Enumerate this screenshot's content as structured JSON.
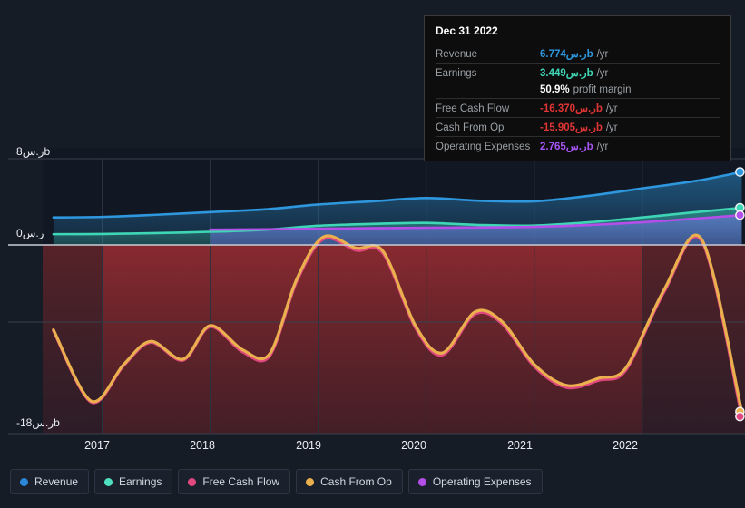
{
  "chart_data": {
    "type": "area",
    "title": "",
    "xlabel": "",
    "ylabel": "",
    "currency_suffix": "ر.سb",
    "xlim": [
      2016.45,
      2022.95
    ],
    "ylim": [
      -18,
      8
    ],
    "grid": true,
    "legend_position": "bottom",
    "x_ticks": [
      "2017",
      "2018",
      "2019",
      "2020",
      "2021",
      "2022"
    ],
    "y_ticks": [
      "8ر.سb",
      "0ر.س",
      "-18ر.سb"
    ],
    "y_tick_values": [
      8,
      0,
      -18
    ],
    "series": [
      {
        "name": "Revenue",
        "color": "#2e97de",
        "fill": "#15496e",
        "x": [
          2016.55,
          2017.0,
          2017.5,
          2018.0,
          2018.5,
          2019.0,
          2019.5,
          2020.0,
          2020.5,
          2021.0,
          2021.5,
          2022.0,
          2022.5,
          2022.92
        ],
        "values": [
          2.55,
          2.6,
          2.8,
          3.05,
          3.3,
          3.75,
          4.05,
          4.35,
          4.1,
          4.05,
          4.55,
          5.25,
          5.95,
          6.774
        ]
      },
      {
        "name": "Earnings",
        "color": "#3fd6b5",
        "fill": "#1c5a5c",
        "x": [
          2016.55,
          2017.0,
          2017.5,
          2018.0,
          2018.5,
          2019.0,
          2019.5,
          2020.0,
          2020.5,
          2021.0,
          2021.5,
          2022.0,
          2022.5,
          2022.92
        ],
        "values": [
          1.0,
          1.02,
          1.1,
          1.22,
          1.4,
          1.78,
          1.95,
          2.05,
          1.85,
          1.8,
          2.1,
          2.55,
          3.05,
          3.449
        ]
      },
      {
        "name": "Free Cash Flow",
        "color": "#e0487f",
        "x": [
          2016.55,
          2016.9,
          2017.2,
          2017.45,
          2017.75,
          2018.0,
          2018.3,
          2018.55,
          2018.8,
          2019.05,
          2019.35,
          2019.6,
          2019.9,
          2020.15,
          2020.45,
          2020.7,
          2021.0,
          2021.3,
          2021.6,
          2021.85,
          2022.2,
          2022.55,
          2022.92
        ],
        "values": [
          -8.2,
          -15.0,
          -11.5,
          -9.3,
          -11.0,
          -7.8,
          -10.2,
          -10.6,
          -3.5,
          0.55,
          -0.5,
          -0.8,
          -7.9,
          -10.5,
          -6.6,
          -7.5,
          -11.6,
          -13.6,
          -12.9,
          -11.9,
          -4.5,
          0.35,
          -16.37
        ]
      },
      {
        "name": "Cash From Op",
        "color": "#eab04e",
        "x": [
          2016.55,
          2016.9,
          2017.2,
          2017.45,
          2017.75,
          2018.0,
          2018.3,
          2018.55,
          2018.8,
          2019.05,
          2019.35,
          2019.6,
          2019.9,
          2020.15,
          2020.45,
          2020.7,
          2021.0,
          2021.3,
          2021.6,
          2021.85,
          2022.2,
          2022.55,
          2022.92
        ],
        "values": [
          -8.1,
          -14.9,
          -11.4,
          -9.2,
          -10.9,
          -7.7,
          -10.0,
          -10.4,
          -3.3,
          0.75,
          -0.3,
          -0.6,
          -7.7,
          -10.3,
          -6.4,
          -7.3,
          -11.4,
          -13.4,
          -12.7,
          -11.7,
          -4.3,
          0.5,
          -15.905
        ]
      },
      {
        "name": "Operating Expenses",
        "color": "#b44ee8",
        "fill": "#3b4a8c",
        "x": [
          2018.0,
          2018.5,
          2019.0,
          2019.5,
          2020.0,
          2020.5,
          2021.0,
          2021.5,
          2022.0,
          2022.5,
          2022.92
        ],
        "values": [
          1.42,
          1.45,
          1.5,
          1.55,
          1.6,
          1.62,
          1.68,
          1.85,
          2.1,
          2.45,
          2.765
        ]
      }
    ]
  },
  "tooltip": {
    "title": "Dec 31 2022",
    "rows": [
      {
        "label": "Revenue",
        "value": "6.774ر.سb",
        "suffix": "/yr",
        "color": "#2e97de"
      },
      {
        "label": "Earnings",
        "value": "3.449ر.سb",
        "suffix": "/yr",
        "color": "#3fd6b5"
      },
      {
        "label": "",
        "value": "50.9%",
        "suffix": "profit margin",
        "color": "#ffffff"
      },
      {
        "label": "Free Cash Flow",
        "value": "-16.370ر.سb",
        "suffix": "/yr",
        "color": "#e03535"
      },
      {
        "label": "Cash From Op",
        "value": "-15.905ر.سb",
        "suffix": "/yr",
        "color": "#e03535"
      },
      {
        "label": "Operating Expenses",
        "value": "2.765ر.سb",
        "suffix": "/yr",
        "color": "#a855f7"
      }
    ]
  },
  "legend": {
    "items": [
      {
        "label": "Revenue",
        "color": "#2b87d9"
      },
      {
        "label": "Earnings",
        "color": "#4ee0c0"
      },
      {
        "label": "Free Cash Flow",
        "color": "#e0487f"
      },
      {
        "label": "Cash From Op",
        "color": "#eab04e"
      },
      {
        "label": "Operating Expenses",
        "color": "#b44ee8"
      }
    ]
  },
  "colors": {
    "background": "#151c26",
    "gridline": "#30384400",
    "zero_line": "#c9ced6",
    "negative_band": "#7e2a2e",
    "negative_band_dim": "#4a2327"
  }
}
